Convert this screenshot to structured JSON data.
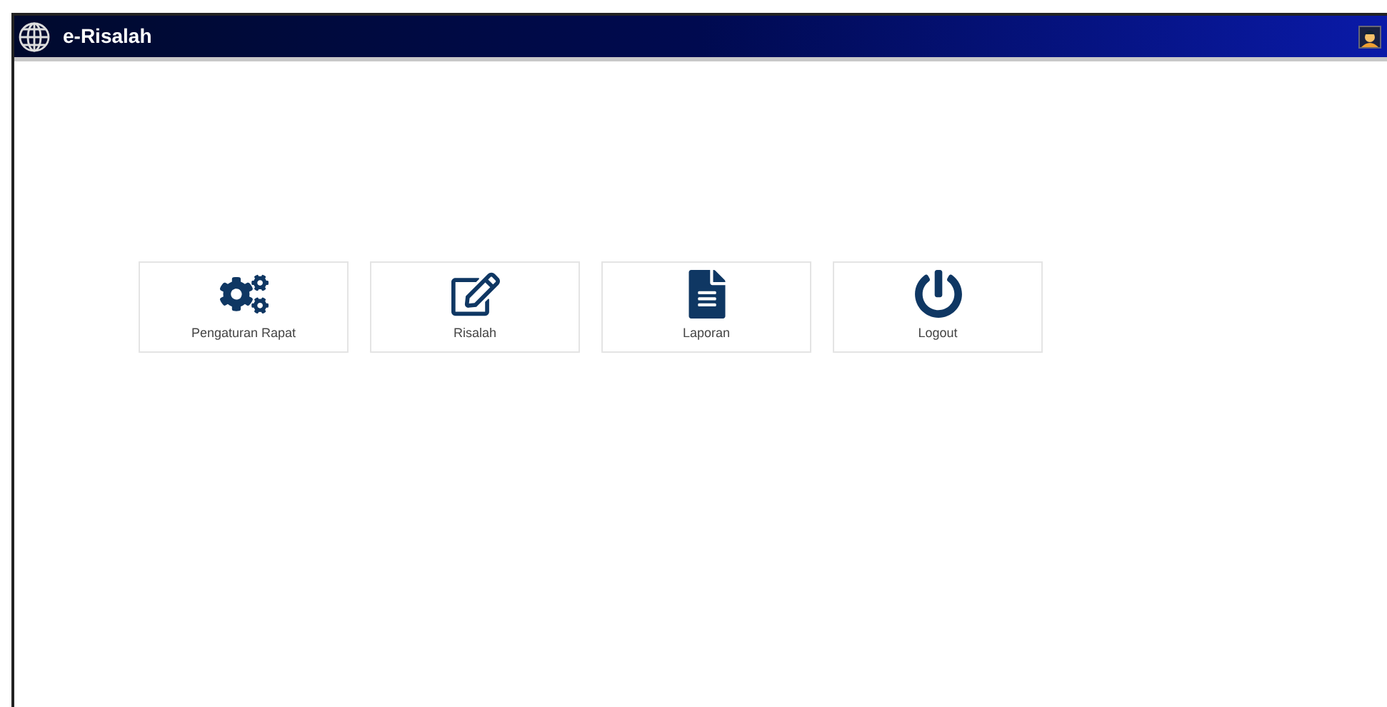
{
  "header": {
    "title": "e-Risalah"
  },
  "menu": [
    {
      "kind": "gears",
      "label": "Pengaturan Rapat"
    },
    {
      "kind": "edit",
      "label": "Risalah"
    },
    {
      "kind": "document",
      "label": "Laporan"
    },
    {
      "kind": "power",
      "label": "Logout"
    }
  ]
}
